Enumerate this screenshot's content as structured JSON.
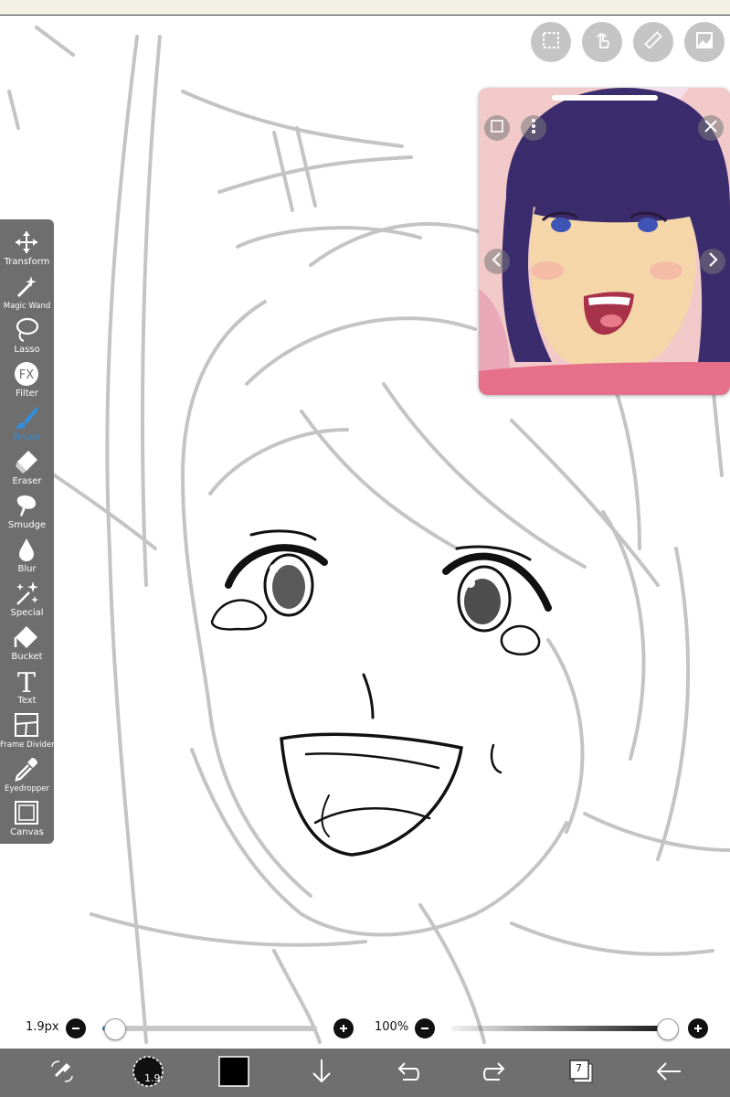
{
  "toolbar": {
    "tools": [
      {
        "label": "Transform",
        "icon": "move-arrows-icon"
      },
      {
        "label": "Magic Wand",
        "icon": "magic-wand-icon"
      },
      {
        "label": "Lasso",
        "icon": "lasso-icon"
      },
      {
        "label": "Filter",
        "icon": "fx-icon"
      },
      {
        "label": "Brush",
        "icon": "brush-icon",
        "active": true
      },
      {
        "label": "Eraser",
        "icon": "eraser-icon"
      },
      {
        "label": "Smudge",
        "icon": "smudge-icon"
      },
      {
        "label": "Blur",
        "icon": "droplet-icon"
      },
      {
        "label": "Special",
        "icon": "sparkle-icon"
      },
      {
        "label": "Bucket",
        "icon": "bucket-icon"
      },
      {
        "label": "Text",
        "icon": "text-icon"
      },
      {
        "label": "Frame Divider",
        "icon": "frame-divider-icon"
      },
      {
        "label": "Eyedropper",
        "icon": "eyedropper-icon"
      },
      {
        "label": "Canvas",
        "icon": "canvas-icon"
      }
    ],
    "active_color": "#2f8fe0"
  },
  "top_buttons": [
    "selection-icon",
    "touch-icon",
    "ruler-icon",
    "reference-image-icon"
  ],
  "reference_window": {
    "icons": [
      "crop-icon",
      "more-vertical-icon",
      "close-icon",
      "chevron-left-icon",
      "chevron-right-icon"
    ]
  },
  "brush": {
    "size_label": "1.9px",
    "size_value": 1.9,
    "size_level": 0.03,
    "opacity_label": "100%",
    "opacity_level": 1.0,
    "indicator": "1.9"
  },
  "bottom_bar": {
    "color": "#000000",
    "layers_count": "7",
    "icons": [
      "swap-eraser-icon",
      "brush-preview-icon",
      "color-swatch-icon",
      "download-icon",
      "undo-icon",
      "redo-icon",
      "layers-icon",
      "back-arrow-icon"
    ]
  }
}
